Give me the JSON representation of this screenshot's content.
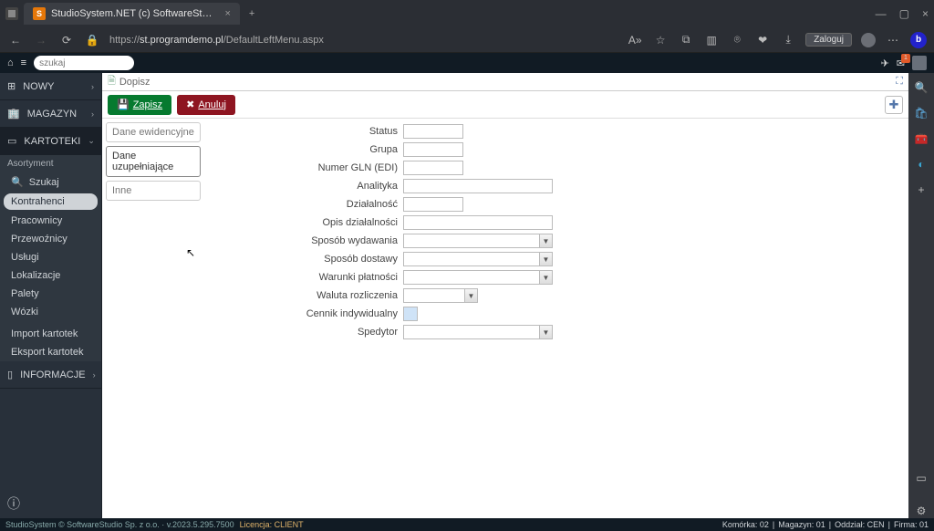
{
  "browser": {
    "tab_title": "StudioSystem.NET (c) SoftwareSt…",
    "favicon_letter": "S",
    "url_proto": "https://",
    "url_host": "st.programdemo.pl",
    "url_path": "/DefaultLeftMenu.aspx",
    "login_label": "Zaloguj"
  },
  "apptop": {
    "search_placeholder": "szukaj",
    "badge_count": "1"
  },
  "leftnav": {
    "section_nowy": "NOWY",
    "section_magazyn": "MAGAZYN",
    "section_kartoteki": "KARTOTEKI",
    "sub_title": "Asortyment",
    "item_szukaj": "Szukaj",
    "items": [
      "Kontrahenci",
      "Pracownicy",
      "Przewoźnicy",
      "Usługi",
      "Lokalizacje",
      "Palety",
      "Wózki"
    ],
    "group2": [
      "Import kartotek",
      "Eksport kartotek"
    ],
    "section_informacje": "INFORMACJE"
  },
  "content": {
    "header_title": "Dopisz",
    "btn_save": "Zapisz",
    "btn_cancel": "Anuluj",
    "tabs": [
      "Dane ewidencyjne",
      "Dane uzupełniające",
      "Inne"
    ],
    "active_tab": 1,
    "fields": {
      "status": "Status",
      "grupa": "Grupa",
      "gln": "Numer GLN (EDI)",
      "analityka": "Analityka",
      "dzialalnosc": "Działalność",
      "opis": "Opis działalności",
      "sposob_wyd": "Sposób wydawania",
      "sposob_dost": "Sposób dostawy",
      "warunki": "Warunki płatności",
      "waluta": "Waluta rozliczenia",
      "cennik": "Cennik indywidualny",
      "spedytor": "Spedytor"
    }
  },
  "status": {
    "left": "StudioSystem © SoftwareStudio Sp. z o.o. · v.2023.5.295.7500",
    "licence": "Licencja: CLIENT",
    "komorka": "Komórka: 02",
    "magazyn": "Magazyn: 01",
    "oddzial": "Oddział: CEN",
    "firma": "Firma: 01"
  }
}
